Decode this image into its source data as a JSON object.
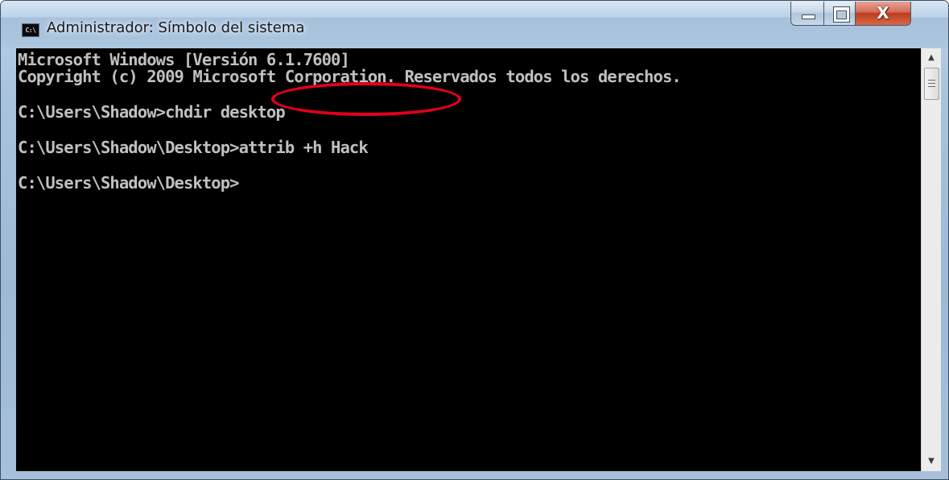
{
  "window": {
    "title": "Administrador: Símbolo del sistema",
    "app_icon_text": "C:\\",
    "controls": {
      "minimize_icon": "minimize-icon",
      "maximize_icon": "maximize-icon",
      "close_icon": "close-icon",
      "close_glyph": "X"
    }
  },
  "console": {
    "lines": [
      "Microsoft Windows [Versión 6.1.7600]",
      "Copyright (c) 2009 Microsoft Corporation. Reservados todos los derechos.",
      "C:\\Users\\Shadow>chdir desktop",
      "C:\\Users\\Shadow\\Desktop>attrib +h Hack",
      "C:\\Users\\Shadow\\Desktop>"
    ],
    "text_color": "#c0c0c0",
    "background_color": "#000000"
  },
  "annotation": {
    "color": "#e4001b",
    "shape": "ellipse"
  },
  "scrollbar": {
    "up_glyph": "▲",
    "down_glyph": "▼"
  }
}
